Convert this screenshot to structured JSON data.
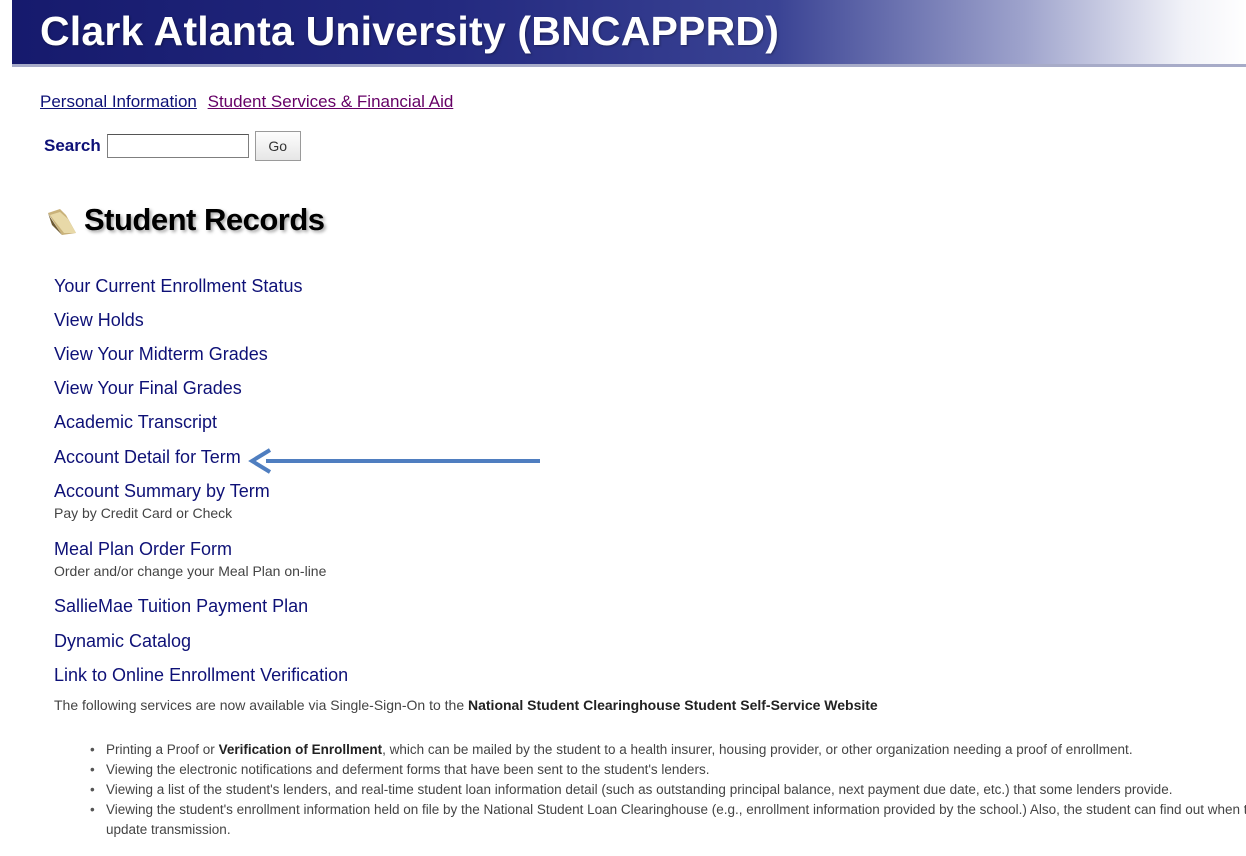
{
  "app": {
    "title": "Clark Atlanta University (BNCAPPRD)"
  },
  "nav": {
    "links": [
      {
        "label": "Personal Information"
      },
      {
        "label": "Student Services & Financial Aid"
      }
    ]
  },
  "search": {
    "label": "Search",
    "value": "",
    "button": "Go"
  },
  "section": {
    "title": "Student Records",
    "icon": "folder-icon"
  },
  "menu": {
    "items": [
      {
        "label": "Your Current Enrollment Status",
        "desc": ""
      },
      {
        "label": "View Holds",
        "desc": ""
      },
      {
        "label": "View Your Midterm Grades",
        "desc": ""
      },
      {
        "label": "View Your Final Grades",
        "desc": ""
      },
      {
        "label": "Academic Transcript",
        "desc": ""
      },
      {
        "label": "Account Detail for Term",
        "desc": ""
      },
      {
        "label": "Account Summary by Term",
        "desc": "Pay by Credit Card or Check"
      },
      {
        "label": "Meal Plan Order Form",
        "desc": "Order and/or change your Meal Plan on-line"
      },
      {
        "label": "SallieMae Tuition Payment Plan",
        "desc": ""
      },
      {
        "label": "Dynamic Catalog",
        "desc": ""
      },
      {
        "label": "Link to Online Enrollment Verification",
        "desc": ""
      }
    ]
  },
  "note": {
    "text": "The following services are now available via Single-Sign-On to the ",
    "bold": "National Student Clearinghouse Student Self-Service Website"
  },
  "bullets": [
    {
      "pre": "Printing a Proof or ",
      "bold": "Verification of Enrollment",
      "post": ", which can be mailed by the student to a health insurer, housing provider, or other organization needing a proof of enrollment."
    },
    {
      "pre": "Viewing the electronic notifications and deferment forms that have been sent to the student's lenders.",
      "bold": "",
      "post": ""
    },
    {
      "pre": "Viewing a list of the student's lenders, and real-time student loan information detail (such as outstanding principal balance, next payment due date, etc.) that some lenders provide.",
      "bold": "",
      "post": ""
    },
    {
      "pre": "Viewing the student's enrollment information held on file by the National Student Loan Clearinghouse (e.g., enrollment information provided by the school.) Also, the student can find out when t",
      "bold": "",
      "post": ""
    }
  ],
  "bullet_continuation": "update transmission.",
  "colors": {
    "link": "#0e1177",
    "visited": "#660066",
    "banner_dark": "#161a6d",
    "arrow": "#4f7ec0"
  }
}
